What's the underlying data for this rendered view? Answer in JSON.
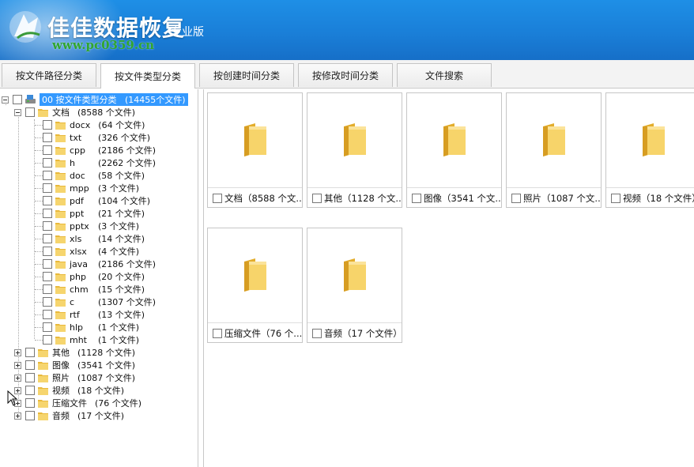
{
  "app": {
    "title": "佳佳数据恢复",
    "edition": "专业版",
    "watermark": "www.pc0359.cn",
    "colors": {
      "header": "#1a7fd8",
      "selection": "#3399ff",
      "folder": "#f5d36b"
    }
  },
  "tabs": [
    {
      "label": "按文件路径分类"
    },
    {
      "label": "按文件类型分类",
      "active": true
    },
    {
      "label": "按创建时间分类"
    },
    {
      "label": "按修改时间分类"
    },
    {
      "label": "文件搜索"
    }
  ],
  "tree": {
    "root": {
      "label": "00  按文件类型分类",
      "count": "(14455个文件)"
    },
    "docs": {
      "label": "文档",
      "count": "(8588 个文件)",
      "children": [
        {
          "label": "docx",
          "count": "(64 个文件)"
        },
        {
          "label": "txt",
          "count": "(326 个文件)"
        },
        {
          "label": "cpp",
          "count": "(2186 个文件)"
        },
        {
          "label": "h",
          "count": "(2262 个文件)"
        },
        {
          "label": "doc",
          "count": "(58 个文件)"
        },
        {
          "label": "mpp",
          "count": "(3 个文件)"
        },
        {
          "label": "pdf",
          "count": "(104 个文件)"
        },
        {
          "label": "ppt",
          "count": "(21 个文件)"
        },
        {
          "label": "pptx",
          "count": "(3 个文件)"
        },
        {
          "label": "xls",
          "count": "(14 个文件)"
        },
        {
          "label": "xlsx",
          "count": "(4 个文件)"
        },
        {
          "label": "java",
          "count": "(2186 个文件)"
        },
        {
          "label": "php",
          "count": "(20 个文件)"
        },
        {
          "label": "chm",
          "count": "(15 个文件)"
        },
        {
          "label": "c",
          "count": "(1307 个文件)"
        },
        {
          "label": "rtf",
          "count": "(13 个文件)"
        },
        {
          "label": "hlp",
          "count": "(1 个文件)"
        },
        {
          "label": "mht",
          "count": "(1 个文件)"
        }
      ]
    },
    "others": [
      {
        "label": "其他",
        "count": "(1128 个文件)"
      },
      {
        "label": "图像",
        "count": "(3541 个文件)"
      },
      {
        "label": "照片",
        "count": "(1087 个文件)"
      },
      {
        "label": "视频",
        "count": "(18 个文件)"
      },
      {
        "label": "压缩文件",
        "count": "(76 个文件)"
      },
      {
        "label": "音频",
        "count": "(17 个文件)"
      }
    ]
  },
  "cards": [
    {
      "caption": "文档（8588 个文..."
    },
    {
      "caption": "其他（1128 个文..."
    },
    {
      "caption": "图像（3541 个文..."
    },
    {
      "caption": "照片（1087 个文..."
    },
    {
      "caption": "视频（18 个文件）"
    },
    {
      "caption": "压缩文件（76 个..."
    },
    {
      "caption": "音频（17 个文件）"
    }
  ]
}
